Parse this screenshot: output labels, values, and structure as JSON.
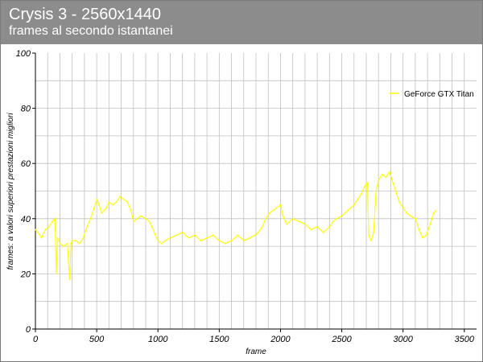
{
  "header": {
    "title": "Crysis 3 - 2560x1440",
    "subtitle": "frames al secondo istantanei"
  },
  "colors": {
    "header_bg": "#8c8c8c",
    "series": "#ffff00",
    "grid": "#c0c0c0"
  },
  "chart_data": {
    "type": "line",
    "title": "Crysis 3 - 2560x1440",
    "subtitle": "frames al secondo istantanei",
    "xlabel": "frame",
    "ylabel": "frames: a valori superiori prestazioni migliori",
    "xlim": [
      0,
      3600
    ],
    "ylim": [
      0,
      100
    ],
    "xticks": [
      0,
      500,
      1000,
      1500,
      2000,
      2500,
      3000,
      3500
    ],
    "yticks": [
      0,
      20,
      40,
      60,
      80,
      100
    ],
    "grid": true,
    "legend_position": "top-right",
    "series": [
      {
        "name": "GeForce GTX Titan",
        "color": "#ffff00",
        "x": [
          0,
          20,
          50,
          80,
          110,
          140,
          160,
          170,
          180,
          200,
          230,
          260,
          280,
          290,
          300,
          330,
          360,
          390,
          420,
          450,
          480,
          500,
          520,
          540,
          560,
          580,
          600,
          630,
          660,
          690,
          720,
          750,
          780,
          800,
          830,
          860,
          900,
          930,
          950,
          980,
          1000,
          1030,
          1060,
          1100,
          1150,
          1200,
          1250,
          1300,
          1350,
          1400,
          1450,
          1500,
          1550,
          1600,
          1650,
          1700,
          1750,
          1790,
          1820,
          1850,
          1880,
          1910,
          1940,
          1970,
          2000,
          2020,
          2050,
          2100,
          2150,
          2200,
          2250,
          2300,
          2350,
          2400,
          2430,
          2460,
          2500,
          2550,
          2600,
          2630,
          2660,
          2690,
          2710,
          2720,
          2740,
          2760,
          2780,
          2800,
          2830,
          2860,
          2890,
          2910,
          2940,
          2970,
          3000,
          3030,
          3060,
          3100,
          3130,
          3160,
          3190,
          3220,
          3250,
          3270
        ],
        "values": [
          36,
          35,
          33,
          36,
          37,
          39,
          40,
          20,
          33,
          31,
          30,
          31,
          18,
          31,
          32,
          32,
          31,
          33,
          37,
          40,
          44,
          47,
          45,
          42,
          43,
          44,
          46,
          45,
          46,
          48,
          47,
          46,
          43,
          39,
          40,
          41,
          40,
          39,
          37,
          34,
          32,
          31,
          32,
          33,
          34,
          35,
          33,
          34,
          32,
          33,
          34,
          32,
          31,
          32,
          34,
          32,
          33,
          34,
          35,
          37,
          40,
          42,
          43,
          44,
          45,
          41,
          38,
          40,
          39,
          38,
          36,
          37,
          35,
          37,
          39,
          40,
          41,
          43,
          45,
          47,
          49,
          52,
          53,
          34,
          32,
          35,
          50,
          54,
          56,
          55,
          57,
          54,
          50,
          46,
          44,
          42,
          41,
          40,
          36,
          33,
          34,
          38,
          42,
          43
        ]
      }
    ]
  }
}
